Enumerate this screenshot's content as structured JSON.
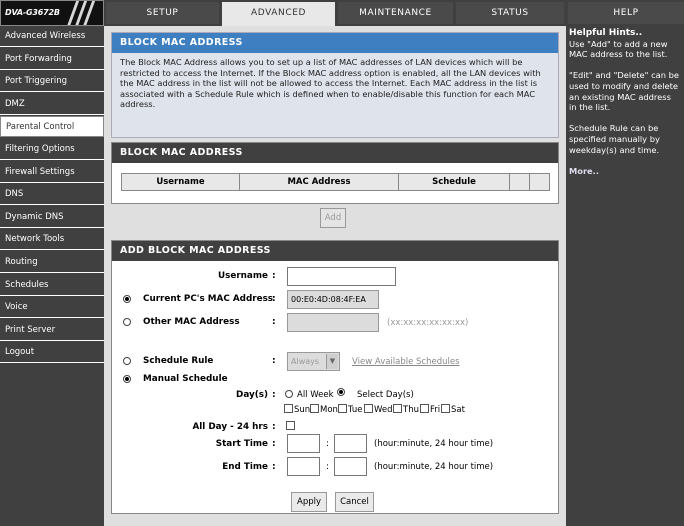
{
  "header": {
    "logo": "DVA-G3672B",
    "tabs": [
      {
        "label": "SETUP"
      },
      {
        "label": "ADVANCED"
      },
      {
        "label": "MAINTENANCE"
      },
      {
        "label": "STATUS"
      },
      {
        "label": "HELP"
      }
    ]
  },
  "sidebar": {
    "items": [
      {
        "label": "Advanced Wireless"
      },
      {
        "label": "Port Forwarding"
      },
      {
        "label": "Port Triggering"
      },
      {
        "label": "DMZ"
      },
      {
        "label": "Parental Control"
      },
      {
        "label": "Filtering Options"
      },
      {
        "label": "Firewall Settings"
      },
      {
        "label": "DNS"
      },
      {
        "label": "Dynamic DNS"
      },
      {
        "label": "Network Tools"
      },
      {
        "label": "Routing"
      },
      {
        "label": "Schedules"
      },
      {
        "label": "Voice"
      },
      {
        "label": "Print Server"
      },
      {
        "label": "Logout"
      }
    ]
  },
  "intro": {
    "title": "BLOCK MAC ADDRESS",
    "text": "The Block MAC Address allows you to set up a list of MAC addresses of LAN devices which will be restricted to access the Internet. If the Block MAC address option is enabled, all the LAN devices with the MAC address in the list will not be allowed to access the Internet. Each MAC address in the list is associated with a Schedule Rule which is defined when to enable/disable this function for each MAC address."
  },
  "list": {
    "title": "BLOCK MAC ADDRESS",
    "columns": [
      "Username",
      "MAC Address",
      "Schedule"
    ],
    "add_label": "Add"
  },
  "form": {
    "title": "ADD BLOCK MAC ADDRESS",
    "username_label": "Username",
    "username_value": "",
    "current_mac_label": "Current PC's MAC Address",
    "current_mac_value": "00:E0:4D:08:4F:EA",
    "other_mac_label": "Other MAC Address",
    "other_mac_value": "",
    "other_mac_hint": "(xx:xx:xx:xx:xx:xx)",
    "schedule_rule_label": "Schedule Rule",
    "schedule_rule_value": "Always",
    "view_schedules_link": "View Available Schedules",
    "manual_schedule_label": "Manual Schedule",
    "days_label": "Day(s)",
    "all_week_label": "All Week",
    "select_days_label": "Select Day(s)",
    "days": [
      "Sun",
      "Mon",
      "Tue",
      "Wed",
      "Thu",
      "Fri",
      "Sat"
    ],
    "all_day_label": "All Day - 24 hrs",
    "start_time_label": "Start Time",
    "end_time_label": "End Time",
    "time_hint": "(hour:minute, 24 hour time)",
    "colon": ":",
    "apply_label": "Apply",
    "cancel_label": "Cancel"
  },
  "hints": {
    "title": "Helpful Hints..",
    "p1": "Use \"Add\" to add a new MAC address to the list.",
    "p2": "\"Edit\" and \"Delete\" can be used to modify and delete an existing MAC address in the list.",
    "p3": "Schedule Rule can be specified manually by weekday(s) and time.",
    "more": "More.."
  }
}
